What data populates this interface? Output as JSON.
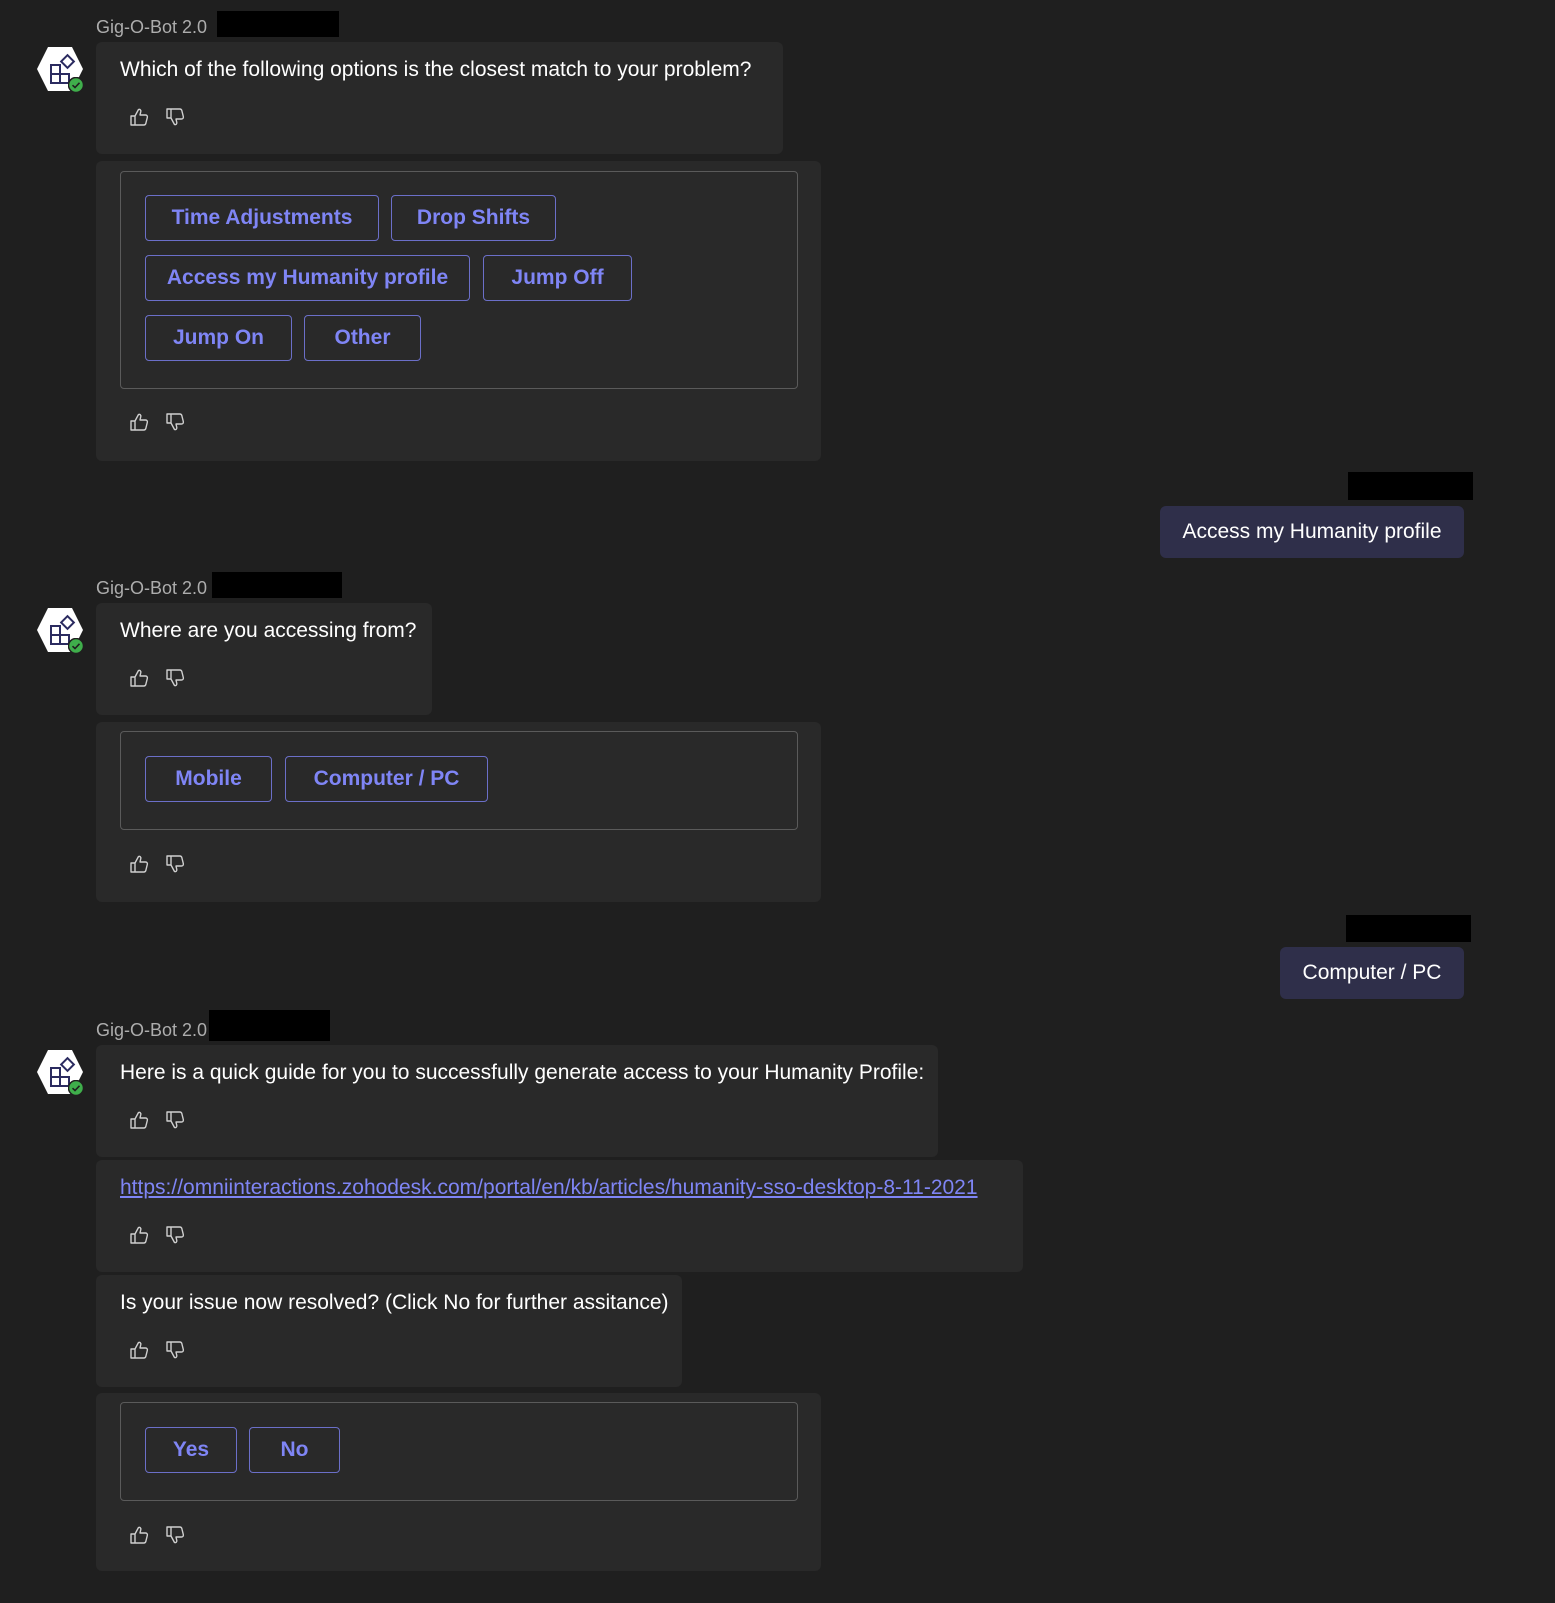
{
  "bot_name": "Gig-O-Bot 2.0",
  "colors": {
    "background": "#1f1f1f",
    "bubble": "#292929",
    "user_bubble": "#2f2f4a",
    "accent": "#7f85f5",
    "presence": "#3fae4b"
  },
  "icons": [
    "bot-avatar-icon",
    "presence-available-icon",
    "thumbs-up-icon",
    "thumbs-down-icon"
  ],
  "block1": {
    "question": "Which of the following options is the closest match to your problem?",
    "options": [
      "Time Adjustments",
      "Drop Shifts",
      "Access my Humanity profile",
      "Jump Off",
      "Jump On",
      "Other"
    ]
  },
  "user_reply1": "Access my Humanity profile",
  "block2": {
    "question": "Where are you accessing from?",
    "options": [
      "Mobile",
      "Computer / PC"
    ]
  },
  "user_reply2": "Computer / PC",
  "block3": {
    "intro": "Here is a quick guide for you to successfully generate access to your Humanity Profile:",
    "link": "https://omniinteractions.zohodesk.com/portal/en/kb/articles/humanity-sso-desktop-8-11-2021",
    "question": "Is your issue now resolved? (Click No for further assitance)",
    "options": [
      "Yes",
      "No"
    ]
  }
}
